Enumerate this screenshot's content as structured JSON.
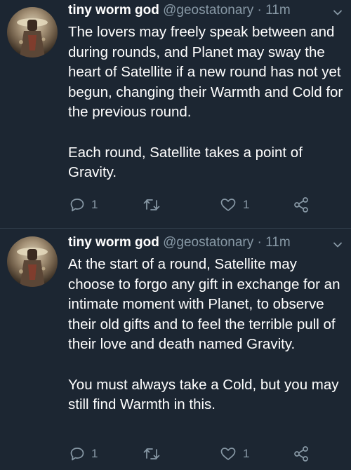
{
  "tweets": [
    {
      "display_name": "tiny worm god",
      "handle": "@geostatonary",
      "separator": "·",
      "time": "11m",
      "paragraphs": [
        "The lovers may freely speak between and during rounds, and Planet may sway the heart of Satellite if a new round has not yet begun, changing their Warmth and Cold for the previous round.",
        "Each round, Satellite takes a point of Gravity."
      ],
      "reply_count": "1",
      "like_count": "1"
    },
    {
      "display_name": "tiny worm god",
      "handle": "@geostatonary",
      "separator": "·",
      "time": "11m",
      "paragraphs": [
        "At the start of a round, Satellite may choose to forgo any gift in exchange for an intimate moment with Planet, to observe their old gifts and to feel the terrible pull of their love and death named Gravity.",
        "You must always take a Cold, but you may still find Warmth in this."
      ],
      "reply_count": "1",
      "like_count": "1"
    }
  ],
  "colors": {
    "background": "#1c2632",
    "text": "#ffffff",
    "secondary": "#8899a6"
  },
  "icons": [
    "reply-icon",
    "retweet-icon",
    "like-icon",
    "share-icon",
    "chevron-down-icon"
  ]
}
